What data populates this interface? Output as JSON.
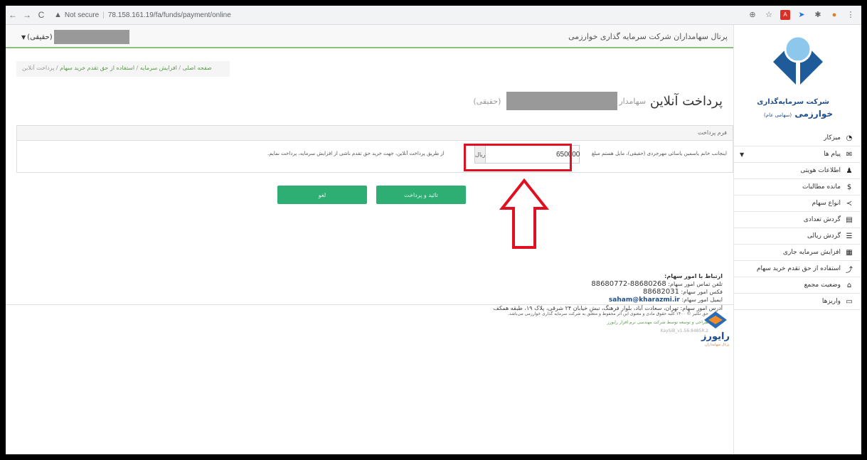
{
  "browser": {
    "security": "Not secure",
    "url": "78.158.161.19/fa/funds/payment/online"
  },
  "header": {
    "portal_title": "پرتال سهامداران شرکت سرمایه گذاری خوارزمی",
    "user_suffix": "(حقیقی)"
  },
  "sidebar": {
    "logo_line1": "شرکت سرمایه‌گذاری",
    "logo_line2": "خوارزمی",
    "logo_line2_small": "(سهامی عام)",
    "items": [
      {
        "label": "میزکار",
        "icon": "dashboard-icon"
      },
      {
        "label": "پیام ها",
        "icon": "envelope-icon"
      },
      {
        "label": "اطلاعات هویتی",
        "icon": "user-icon"
      },
      {
        "label": "مانده مطالبات",
        "icon": "dollar-icon"
      },
      {
        "label": "انواع سهام",
        "icon": "share-icon"
      },
      {
        "label": "گردش تعدادی",
        "icon": "list-alt-icon"
      },
      {
        "label": "گردش ریالی",
        "icon": "list-icon"
      },
      {
        "label": "افزایش سرمایه جاری",
        "icon": "calculator-icon"
      },
      {
        "label": "استفاده از حق تقدم خرید سهام",
        "icon": "chart-icon"
      },
      {
        "label": "وضعیت مجمع",
        "icon": "bank-icon"
      },
      {
        "label": "واریزها",
        "icon": "card-icon"
      }
    ]
  },
  "breadcrumb": {
    "home": "صفحه اصلی",
    "capital": "افزایش سرمایه",
    "rights": "استفاده از حق تقدم خرید سهام",
    "current": "پرداخت آنلاین"
  },
  "page": {
    "title": "پرداخت آنلاین",
    "subtitle_prefix": "سهامدار",
    "subtitle_suffix": "(حقیقی)"
  },
  "form": {
    "panel_title": "فرم پرداخت",
    "sentence_before": "اینجانب خانم یاسمین یاسائی مهرجردی (حقیقی)، مایل هستم مبلغ",
    "amount": "650000",
    "currency": "ریال",
    "sentence_after": "از طریق پرداخت آنلاین، جهت خرید حق تقدم ناشی از افزایش سرمایه، پرداخت نمایم."
  },
  "buttons": {
    "confirm": "تائید و پرداخت",
    "cancel": "لغو"
  },
  "contact": {
    "title": "ارتباط با امور سهام:",
    "phone_label": "تلفن تماس امور سهام:",
    "phone": "88680268-88680772",
    "fax_label": "فکس امور سهام:",
    "fax": "88682031",
    "email_label": "ایمیل امور سهام:",
    "email": "saham@kharazmi.ir",
    "address": "آدرس امور سهام: تهران، سعادت آباد، بلوار فرهنگ، نبش خیابان ۲۴ شرقی، پلاک ۱۹، طبقه همکف"
  },
  "footer": {
    "copyright": "حق تکثیر © ۱۴۰۰ کلیه حقوق مادی و معنوی این اثر محفوظ و متعلق به شرکت سرمایه گذاری خوارزمی می‌باشد.",
    "design": "طراحی و توسعه توسط شرکت مهندسی نرم افزار رایورز",
    "version": "KaySiB_v1.56.8485R.2",
    "brand": "رایورز",
    "brand_sub": "پرتال سهامداران"
  },
  "colors": {
    "accent_green": "#2fae74",
    "highlight_red": "#e01020",
    "brand_blue": "#1f4e8c"
  }
}
